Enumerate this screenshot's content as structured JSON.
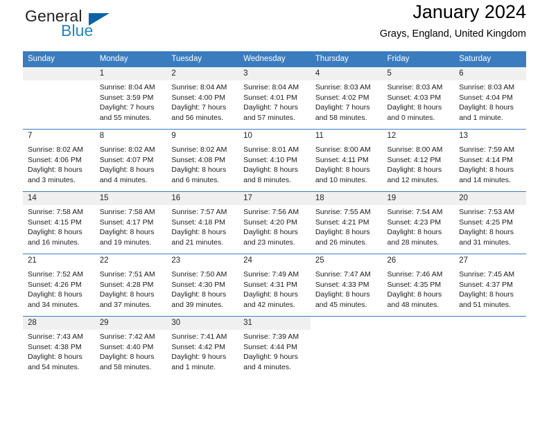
{
  "brand": {
    "word1": "General",
    "word2": "Blue",
    "logo_icon": "triangle-logo-icon",
    "color_dark": "#231f20",
    "color_blue": "#2382c6"
  },
  "header": {
    "title": "January 2024",
    "subtitle": "Grays, England, United Kingdom"
  },
  "theme": {
    "header_bg": "#3a7cbe",
    "header_text": "#ffffff",
    "daynum_bg": "#f0f0f0",
    "grid_line": "#3a7cbe"
  },
  "weekday_headers": [
    "Sunday",
    "Monday",
    "Tuesday",
    "Wednesday",
    "Thursday",
    "Friday",
    "Saturday"
  ],
  "weeks": [
    [
      {
        "day": "",
        "sunrise": "",
        "sunset": "",
        "daylight1": "",
        "daylight2": "",
        "empty": true
      },
      {
        "day": "1",
        "sunrise": "Sunrise: 8:04 AM",
        "sunset": "Sunset: 3:59 PM",
        "daylight1": "Daylight: 7 hours",
        "daylight2": "and 55 minutes."
      },
      {
        "day": "2",
        "sunrise": "Sunrise: 8:04 AM",
        "sunset": "Sunset: 4:00 PM",
        "daylight1": "Daylight: 7 hours",
        "daylight2": "and 56 minutes."
      },
      {
        "day": "3",
        "sunrise": "Sunrise: 8:04 AM",
        "sunset": "Sunset: 4:01 PM",
        "daylight1": "Daylight: 7 hours",
        "daylight2": "and 57 minutes."
      },
      {
        "day": "4",
        "sunrise": "Sunrise: 8:03 AM",
        "sunset": "Sunset: 4:02 PM",
        "daylight1": "Daylight: 7 hours",
        "daylight2": "and 58 minutes."
      },
      {
        "day": "5",
        "sunrise": "Sunrise: 8:03 AM",
        "sunset": "Sunset: 4:03 PM",
        "daylight1": "Daylight: 8 hours",
        "daylight2": "and 0 minutes."
      },
      {
        "day": "6",
        "sunrise": "Sunrise: 8:03 AM",
        "sunset": "Sunset: 4:04 PM",
        "daylight1": "Daylight: 8 hours",
        "daylight2": "and 1 minute."
      }
    ],
    [
      {
        "day": "7",
        "sunrise": "Sunrise: 8:02 AM",
        "sunset": "Sunset: 4:06 PM",
        "daylight1": "Daylight: 8 hours",
        "daylight2": "and 3 minutes."
      },
      {
        "day": "8",
        "sunrise": "Sunrise: 8:02 AM",
        "sunset": "Sunset: 4:07 PM",
        "daylight1": "Daylight: 8 hours",
        "daylight2": "and 4 minutes."
      },
      {
        "day": "9",
        "sunrise": "Sunrise: 8:02 AM",
        "sunset": "Sunset: 4:08 PM",
        "daylight1": "Daylight: 8 hours",
        "daylight2": "and 6 minutes."
      },
      {
        "day": "10",
        "sunrise": "Sunrise: 8:01 AM",
        "sunset": "Sunset: 4:10 PM",
        "daylight1": "Daylight: 8 hours",
        "daylight2": "and 8 minutes."
      },
      {
        "day": "11",
        "sunrise": "Sunrise: 8:00 AM",
        "sunset": "Sunset: 4:11 PM",
        "daylight1": "Daylight: 8 hours",
        "daylight2": "and 10 minutes."
      },
      {
        "day": "12",
        "sunrise": "Sunrise: 8:00 AM",
        "sunset": "Sunset: 4:12 PM",
        "daylight1": "Daylight: 8 hours",
        "daylight2": "and 12 minutes."
      },
      {
        "day": "13",
        "sunrise": "Sunrise: 7:59 AM",
        "sunset": "Sunset: 4:14 PM",
        "daylight1": "Daylight: 8 hours",
        "daylight2": "and 14 minutes."
      }
    ],
    [
      {
        "day": "14",
        "sunrise": "Sunrise: 7:58 AM",
        "sunset": "Sunset: 4:15 PM",
        "daylight1": "Daylight: 8 hours",
        "daylight2": "and 16 minutes."
      },
      {
        "day": "15",
        "sunrise": "Sunrise: 7:58 AM",
        "sunset": "Sunset: 4:17 PM",
        "daylight1": "Daylight: 8 hours",
        "daylight2": "and 19 minutes."
      },
      {
        "day": "16",
        "sunrise": "Sunrise: 7:57 AM",
        "sunset": "Sunset: 4:18 PM",
        "daylight1": "Daylight: 8 hours",
        "daylight2": "and 21 minutes."
      },
      {
        "day": "17",
        "sunrise": "Sunrise: 7:56 AM",
        "sunset": "Sunset: 4:20 PM",
        "daylight1": "Daylight: 8 hours",
        "daylight2": "and 23 minutes."
      },
      {
        "day": "18",
        "sunrise": "Sunrise: 7:55 AM",
        "sunset": "Sunset: 4:21 PM",
        "daylight1": "Daylight: 8 hours",
        "daylight2": "and 26 minutes."
      },
      {
        "day": "19",
        "sunrise": "Sunrise: 7:54 AM",
        "sunset": "Sunset: 4:23 PM",
        "daylight1": "Daylight: 8 hours",
        "daylight2": "and 28 minutes."
      },
      {
        "day": "20",
        "sunrise": "Sunrise: 7:53 AM",
        "sunset": "Sunset: 4:25 PM",
        "daylight1": "Daylight: 8 hours",
        "daylight2": "and 31 minutes."
      }
    ],
    [
      {
        "day": "21",
        "sunrise": "Sunrise: 7:52 AM",
        "sunset": "Sunset: 4:26 PM",
        "daylight1": "Daylight: 8 hours",
        "daylight2": "and 34 minutes."
      },
      {
        "day": "22",
        "sunrise": "Sunrise: 7:51 AM",
        "sunset": "Sunset: 4:28 PM",
        "daylight1": "Daylight: 8 hours",
        "daylight2": "and 37 minutes."
      },
      {
        "day": "23",
        "sunrise": "Sunrise: 7:50 AM",
        "sunset": "Sunset: 4:30 PM",
        "daylight1": "Daylight: 8 hours",
        "daylight2": "and 39 minutes."
      },
      {
        "day": "24",
        "sunrise": "Sunrise: 7:49 AM",
        "sunset": "Sunset: 4:31 PM",
        "daylight1": "Daylight: 8 hours",
        "daylight2": "and 42 minutes."
      },
      {
        "day": "25",
        "sunrise": "Sunrise: 7:47 AM",
        "sunset": "Sunset: 4:33 PM",
        "daylight1": "Daylight: 8 hours",
        "daylight2": "and 45 minutes."
      },
      {
        "day": "26",
        "sunrise": "Sunrise: 7:46 AM",
        "sunset": "Sunset: 4:35 PM",
        "daylight1": "Daylight: 8 hours",
        "daylight2": "and 48 minutes."
      },
      {
        "day": "27",
        "sunrise": "Sunrise: 7:45 AM",
        "sunset": "Sunset: 4:37 PM",
        "daylight1": "Daylight: 8 hours",
        "daylight2": "and 51 minutes."
      }
    ],
    [
      {
        "day": "28",
        "sunrise": "Sunrise: 7:43 AM",
        "sunset": "Sunset: 4:38 PM",
        "daylight1": "Daylight: 8 hours",
        "daylight2": "and 54 minutes."
      },
      {
        "day": "29",
        "sunrise": "Sunrise: 7:42 AM",
        "sunset": "Sunset: 4:40 PM",
        "daylight1": "Daylight: 8 hours",
        "daylight2": "and 58 minutes."
      },
      {
        "day": "30",
        "sunrise": "Sunrise: 7:41 AM",
        "sunset": "Sunset: 4:42 PM",
        "daylight1": "Daylight: 9 hours",
        "daylight2": "and 1 minute."
      },
      {
        "day": "31",
        "sunrise": "Sunrise: 7:39 AM",
        "sunset": "Sunset: 4:44 PM",
        "daylight1": "Daylight: 9 hours",
        "daylight2": "and 4 minutes."
      },
      {
        "day": "",
        "sunrise": "",
        "sunset": "",
        "daylight1": "",
        "daylight2": "",
        "blank": true
      },
      {
        "day": "",
        "sunrise": "",
        "sunset": "",
        "daylight1": "",
        "daylight2": "",
        "blank": true
      },
      {
        "day": "",
        "sunrise": "",
        "sunset": "",
        "daylight1": "",
        "daylight2": "",
        "blank": true
      }
    ]
  ]
}
